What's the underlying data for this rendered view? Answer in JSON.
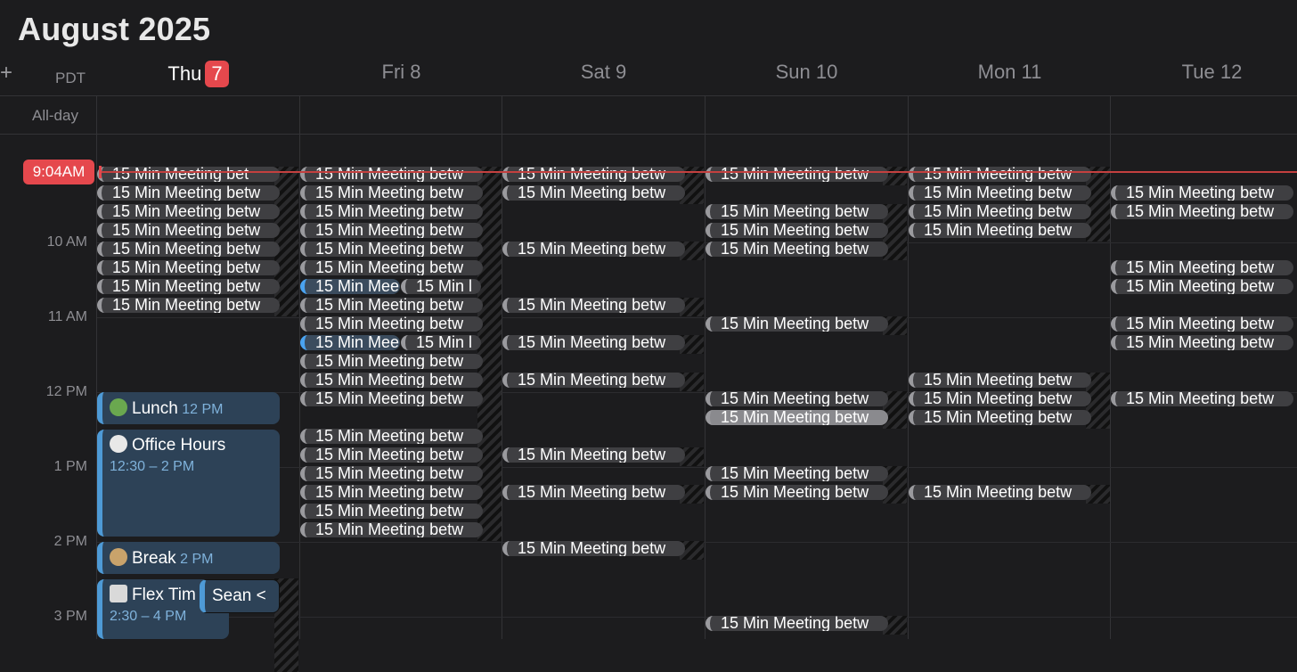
{
  "month_title": "August 2025",
  "timezone": "PDT",
  "add_icon": "+",
  "all_day_label": "All-day",
  "now_time": "9:04AM",
  "days": [
    {
      "name": "Thu",
      "date": "7",
      "today": true
    },
    {
      "name": "Fri 8"
    },
    {
      "name": "Sat 9"
    },
    {
      "name": "Sun 10"
    },
    {
      "name": "Mon 11"
    },
    {
      "name": "Tue 12"
    }
  ],
  "hours": [
    "10 AM",
    "11 AM",
    "12 PM",
    "1 PM",
    "2 PM",
    "3 PM"
  ],
  "meeting_label": "15 Min Meeting betw",
  "meeting_short": "15 Min Mee",
  "meeting_short2": "15 Min l",
  "thu_first": "15 Min Meeting bet",
  "events": {
    "lunch": {
      "icon": "salad-icon",
      "title": "Lunch",
      "time": "12 PM"
    },
    "office_hours": {
      "icon": "clock-icon",
      "title": "Office Hours",
      "time": "12:30 – 2 PM"
    },
    "break": {
      "icon": "bowl-icon",
      "title": "Break",
      "time": "2 PM"
    },
    "flex": {
      "icon": "book-icon",
      "title": "Flex Tim",
      "time": "2:30 – 4 PM"
    },
    "sean": {
      "title": "Sean <"
    }
  }
}
